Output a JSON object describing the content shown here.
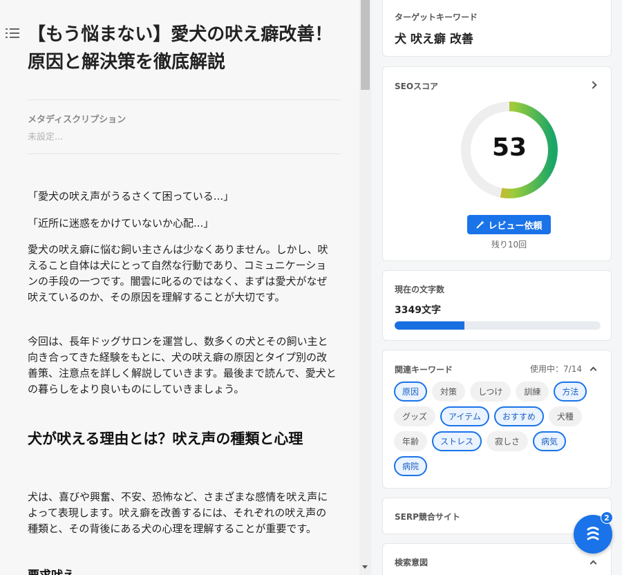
{
  "editor": {
    "title": "【もう悩まない】愛犬の吠え癖改善！原因と解決策を徹底解説",
    "meta_label": "メタディスクリプション",
    "meta_value": "未設定...",
    "paragraphs": [
      "「愛犬の吠え声がうるさくて困っている...」",
      "「近所に迷惑をかけていないか心配...」",
      "愛犬の吠え癖に悩む飼い主さんは少なくありません。しかし、吠えること自体は犬にとって自然な行動であり、コミュニケーションの手段の一つです。闇雲に叱るのではなく、まずは愛犬がなぜ吠えているのか、その原因を理解することが大切です。",
      "今回は、長年ドッグサロンを運営し、数多くの犬とその飼い主と向き合ってきた経験をもとに、犬の吠え癖の原因とタイプ別の改善策、注意点を詳しく解説していきます。最後まで読んで、愛犬との暮らしをより良いものにしていきましょう。"
    ],
    "heading2": "犬が吠える理由とは？吠え声の種類と心理",
    "paragraph_after_h2": "犬は、喜びや興奮、不安、恐怖など、さまざまな感情を吠え声によって表現します。吠え癖を改善するには、それぞれの吠え声の種類と、その背後にある犬の心理を理解することが重要です。",
    "heading3": "要求吠え"
  },
  "target_keyword": {
    "label": "ターゲットキーワード",
    "value": "犬 吠え癖 改善"
  },
  "seo_score": {
    "label": "SEOスコア",
    "score": 53,
    "max": 100,
    "review_button": "レビュー依頼",
    "remaining": "残り10回"
  },
  "char_count": {
    "label": "現在の文字数",
    "value": "3349文字",
    "progress": 0.34
  },
  "related_keywords": {
    "label": "関連キーワード",
    "usage": "使用中：7/14",
    "items": [
      {
        "text": "原因",
        "used": true
      },
      {
        "text": "対策",
        "used": false
      },
      {
        "text": "しつけ",
        "used": false
      },
      {
        "text": "訓練",
        "used": false
      },
      {
        "text": "方法",
        "used": true
      },
      {
        "text": "グッズ",
        "used": false
      },
      {
        "text": "アイテム",
        "used": true
      },
      {
        "text": "おすすめ",
        "used": true
      },
      {
        "text": "犬種",
        "used": false
      },
      {
        "text": "年齢",
        "used": false
      },
      {
        "text": "ストレス",
        "used": true
      },
      {
        "text": "寂しさ",
        "used": false
      },
      {
        "text": "病気",
        "used": true
      },
      {
        "text": "病院",
        "used": true
      }
    ]
  },
  "serp": {
    "label": "SERP競合サイト"
  },
  "search_intent": {
    "label": "検索意図"
  },
  "fab": {
    "badge": "2"
  },
  "colors": {
    "accent": "#1a73e8",
    "used_chip_bg": "#eaf3ff"
  }
}
